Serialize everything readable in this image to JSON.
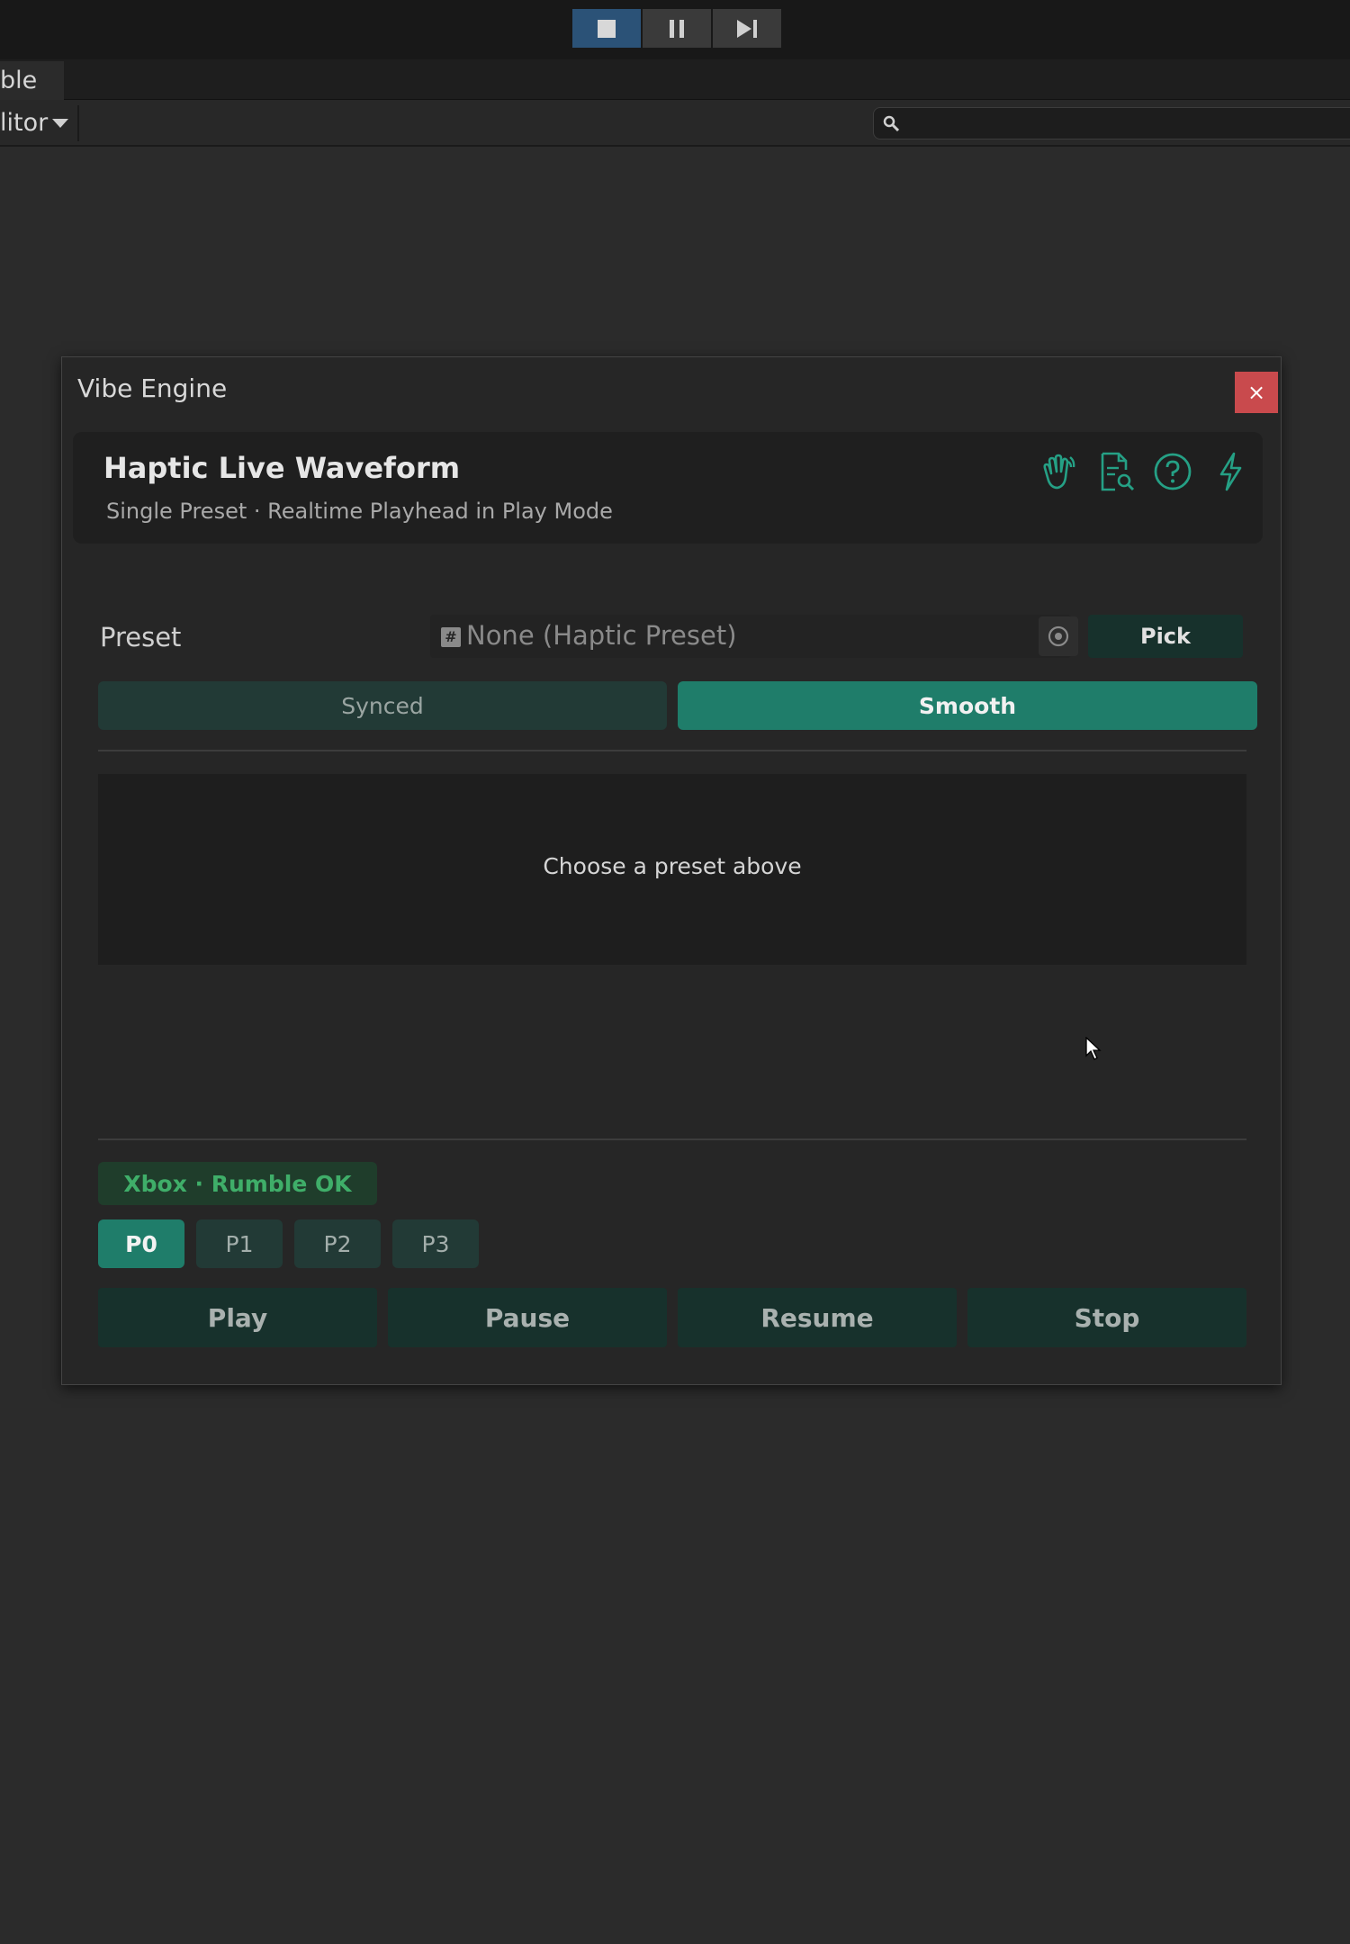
{
  "toolbar": {
    "buttons": [
      "stop",
      "pause",
      "step"
    ]
  },
  "tabbar": {
    "tab_label": "ble"
  },
  "subbar": {
    "dropdown_label": "litor",
    "search_placeholder": ""
  },
  "window": {
    "title": "Vibe Engine",
    "close_label": "×",
    "header": {
      "title": "Haptic Live Waveform",
      "subtitle": "Single Preset · Realtime Playhead in Play Mode",
      "icons": [
        "hand-wave-icon",
        "document-search-icon",
        "help-circle-icon",
        "lightning-icon"
      ]
    },
    "preset": {
      "label": "Preset",
      "value": "None (Haptic Preset)",
      "pick_label": "Pick"
    },
    "modes": {
      "synced": "Synced",
      "smooth": "Smooth",
      "selected": "Smooth"
    },
    "waveform": {
      "message": "Choose a preset above"
    },
    "status": "Xbox · Rumble OK",
    "players": [
      "P0",
      "P1",
      "P2",
      "P3"
    ],
    "selected_player": "P0",
    "actions": {
      "play": "Play",
      "pause": "Pause",
      "resume": "Resume",
      "stop": "Stop"
    }
  },
  "colors": {
    "accent": "#1f7d6a",
    "close": "#c94a4d",
    "status_text": "#3fae69"
  }
}
